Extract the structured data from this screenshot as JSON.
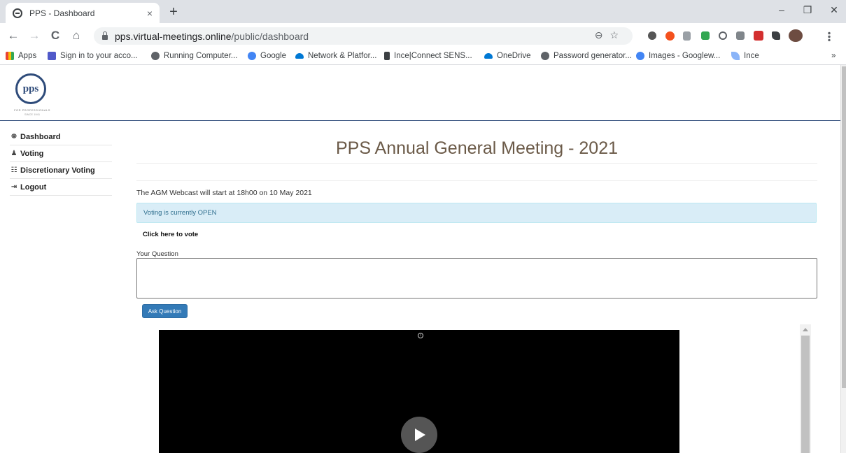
{
  "browser": {
    "tab_title": "PPS - Dashboard",
    "tab_close": "×",
    "new_tab": "+",
    "url_host": "pps.virtual-meetings.online",
    "url_path": "/public/dashboard",
    "window_controls": {
      "minimize": "–",
      "restore": "❐",
      "close": "✕"
    },
    "nav": {
      "back": "←",
      "forward": "→",
      "reload": "C",
      "home": "⌂"
    },
    "omnibox_icons": "⊖☆",
    "bookmarks": [
      {
        "label": "Apps",
        "color": "#ea4335"
      },
      {
        "label": "Sign in to your acco...",
        "color": "#5059c9"
      },
      {
        "label": "Running Computer...",
        "color": "#5f6368"
      },
      {
        "label": "Google",
        "color": "#4285f4"
      },
      {
        "label": "Network & Platfor...",
        "color": "#0078d4"
      },
      {
        "label": "Ince|Connect SENS...",
        "color": "#3c4043"
      },
      {
        "label": "OneDrive",
        "color": "#0078d4"
      },
      {
        "label": "Password generator...",
        "color": "#5f6368"
      },
      {
        "label": "Images - Googlew...",
        "color": "#4285f4"
      },
      {
        "label": "Ince",
        "color": "#8ab4f8"
      }
    ],
    "bookmarks_more": "»"
  },
  "page": {
    "logo_text": "pps",
    "logo_tagline": "FOR PROFESSIONALS",
    "logo_since": "SINCE 1941",
    "sidebar": [
      {
        "label": "Dashboard",
        "icon": "⛯"
      },
      {
        "label": "Voting",
        "icon": "♟"
      },
      {
        "label": "Discretionary Voting",
        "icon": "☷"
      },
      {
        "label": "Logout",
        "icon": "⇥"
      }
    ],
    "title": "PPS Annual General Meeting - 2021",
    "webcast_text": "The AGM Webcast will start at 18h00 on 10 May 2021",
    "voting_status": "Voting is currently OPEN",
    "vote_link": "Click here to vote",
    "question_label": "Your Question",
    "ask_button": "Ask Question",
    "video_info": "i"
  },
  "colors": {
    "brand": "#2e4b7a",
    "title": "#6b5a48",
    "alert_bg": "#d9edf7",
    "button": "#337ab7"
  }
}
